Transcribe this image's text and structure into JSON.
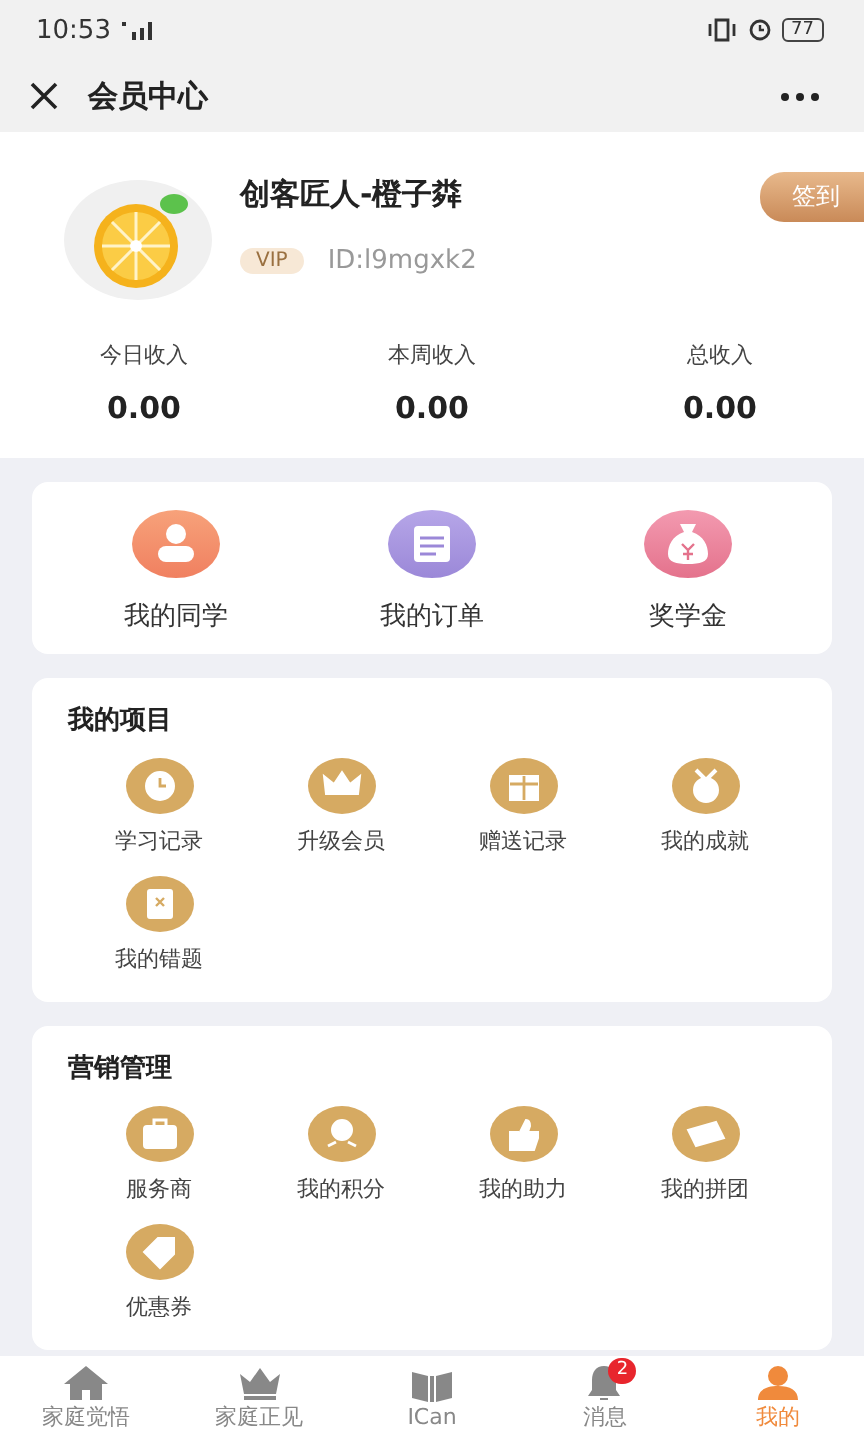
{
  "status_bar": {
    "time": "10:53",
    "battery": "77"
  },
  "nav": {
    "title": "会员中心"
  },
  "profile": {
    "name": "创客匠人-橙子粦",
    "badge": "VIP",
    "id": "ID:l9mgxk2",
    "checkin": "签到"
  },
  "income": [
    {
      "label": "今日收入",
      "value": "0.00"
    },
    {
      "label": "本周收入",
      "value": "0.00"
    },
    {
      "label": "总收入",
      "value": "0.00"
    }
  ],
  "shortcuts": [
    {
      "label": "我的同学"
    },
    {
      "label": "我的订单"
    },
    {
      "label": "奖学金"
    }
  ],
  "sections": [
    {
      "title": "我的项目",
      "items": [
        {
          "label": "学习记录"
        },
        {
          "label": "升级会员"
        },
        {
          "label": "赠送记录"
        },
        {
          "label": "我的成就"
        },
        {
          "label": "我的错题"
        }
      ]
    },
    {
      "title": "营销管理",
      "items": [
        {
          "label": "服务商"
        },
        {
          "label": "我的积分"
        },
        {
          "label": "我的助力"
        },
        {
          "label": "我的拼团"
        },
        {
          "label": "优惠券"
        }
      ]
    }
  ],
  "tabs": [
    {
      "label": "家庭觉悟",
      "selected": false
    },
    {
      "label": "家庭正见",
      "selected": false
    },
    {
      "label": "ICan",
      "selected": false
    },
    {
      "label": "消息",
      "selected": false,
      "badge": "2"
    },
    {
      "label": "我的",
      "selected": true
    }
  ]
}
